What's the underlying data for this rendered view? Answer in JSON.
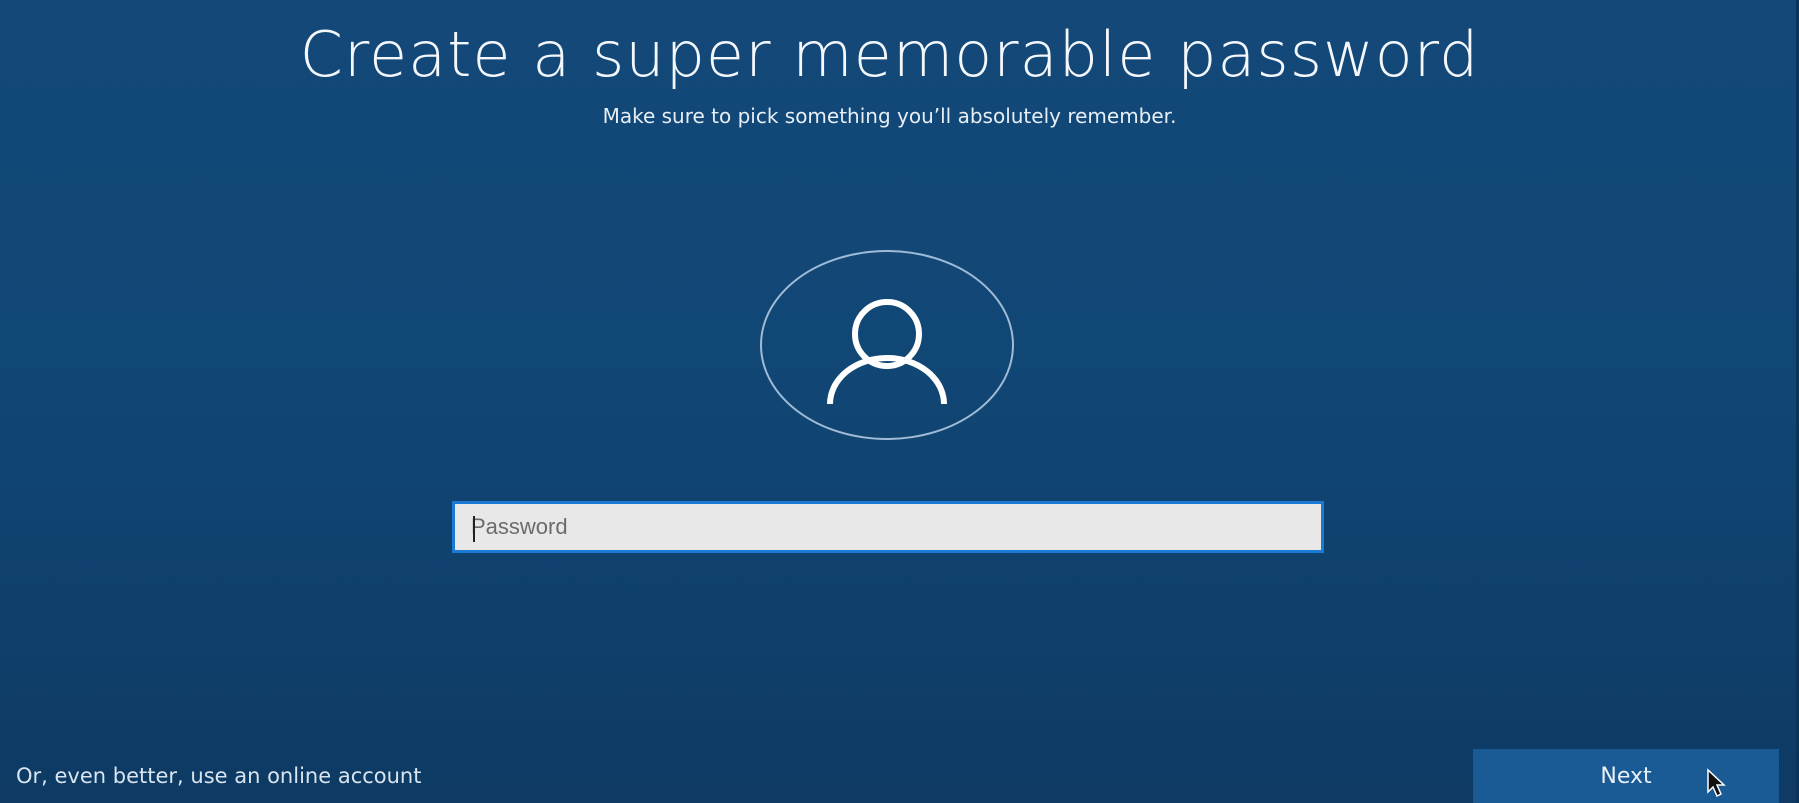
{
  "header": {
    "title": "Create a super memorable password",
    "subtitle": "Make sure to pick something you’ll absolutely remember."
  },
  "avatar": {
    "icon": "user-icon"
  },
  "password": {
    "placeholder": "Password",
    "value": ""
  },
  "footer": {
    "online_account_link": "Or, even better, use an online account",
    "next_label": "Next"
  },
  "colors": {
    "background": "#134878",
    "field_border": "#1b7bd4",
    "next_button": "#1a5a95"
  },
  "pointer": {
    "icon": "mouse-pointer-icon"
  }
}
